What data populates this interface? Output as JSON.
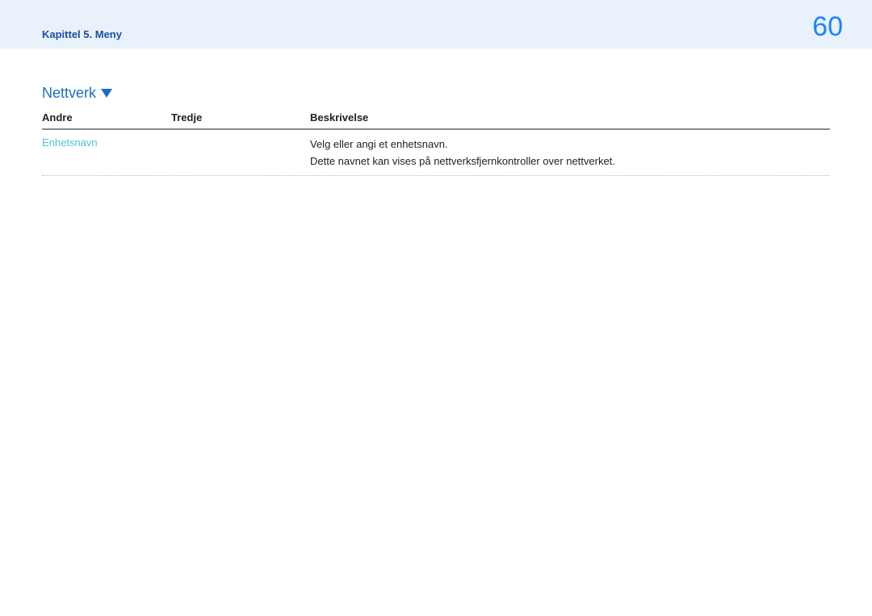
{
  "header": {
    "chapter": "Kapittel 5. Meny",
    "page_number": "60"
  },
  "section": {
    "title": "Nettverk"
  },
  "table": {
    "headers": {
      "col1": "Andre",
      "col2": "Tredje",
      "col3": "Beskrivelse"
    },
    "rows": [
      {
        "andre": "Enhetsnavn",
        "tredje": "",
        "beskrivelse_line1": "Velg eller angi et enhetsnavn.",
        "beskrivelse_line2": "Dette navnet kan vises på nettverksfjernkontroller over nettverket."
      }
    ]
  }
}
